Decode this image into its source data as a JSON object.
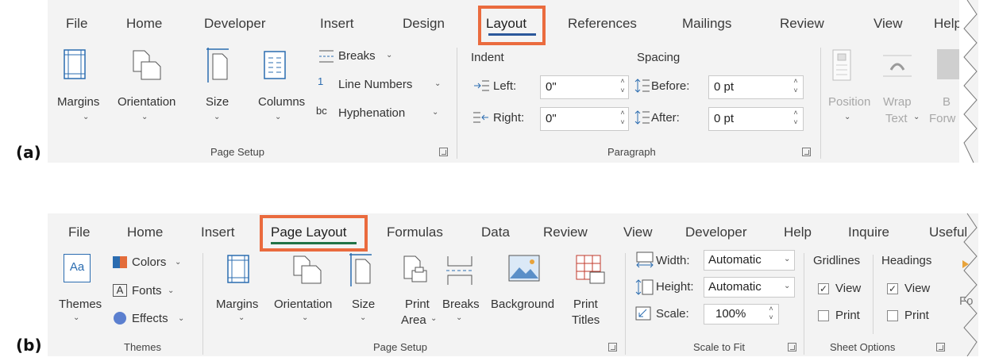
{
  "panel_a": {
    "label": "(a)",
    "tabs": [
      "File",
      "Home",
      "Developer",
      "Insert",
      "Design",
      "Layout",
      "References",
      "Mailings",
      "Review",
      "View",
      "Help"
    ],
    "active_tab": "Layout",
    "highlight_color": "#ea6b3e",
    "underline_color": "#2b579a",
    "page_setup": {
      "margins": "Margins",
      "orientation": "Orientation",
      "size": "Size",
      "columns": "Columns",
      "breaks": "Breaks",
      "line_numbers": "Line Numbers",
      "hyphenation": "Hyphenation",
      "group": "Page Setup"
    },
    "paragraph": {
      "indent": "Indent",
      "spacing": "Spacing",
      "left_label": "Left:",
      "left_value": "0\"",
      "right_label": "Right:",
      "right_value": "0\"",
      "before_label": "Before:",
      "before_value": "0 pt",
      "after_label": "After:",
      "after_value": "0 pt",
      "group": "Paragraph"
    },
    "arrange": {
      "position": "Position",
      "wrap": "Wrap",
      "text": "Text",
      "forward": "Forw",
      "bring": "B"
    }
  },
  "panel_b": {
    "label": "(b)",
    "tabs": [
      "File",
      "Home",
      "Insert",
      "Page Layout",
      "Formulas",
      "Data",
      "Review",
      "View",
      "Developer",
      "Help",
      "Inquire",
      "Useful"
    ],
    "active_tab": "Page Layout",
    "underline_color": "#217346",
    "themes": {
      "themes": "Themes",
      "colors": "Colors",
      "fonts": "Fonts",
      "effects": "Effects",
      "group": "Themes",
      "icon_text": "Aa",
      "fonts_icon": "A"
    },
    "page_setup": {
      "margins": "Margins",
      "orientation": "Orientation",
      "size": "Size",
      "print": "Print",
      "area": "Area",
      "breaks": "Breaks",
      "background": "Background",
      "print_titles_1": "Print",
      "print_titles_2": "Titles",
      "group": "Page Setup"
    },
    "scale": {
      "width_label": "Width:",
      "width_value": "Automatic",
      "height_label": "Height:",
      "height_value": "Automatic",
      "scale_label": "Scale:",
      "scale_value": "100%",
      "group": "Scale to Fit"
    },
    "sheet_options": {
      "gridlines": "Gridlines",
      "headings": "Headings",
      "view": "View",
      "print": "Print",
      "group": "Sheet Options"
    },
    "cut_off": "Fo"
  }
}
